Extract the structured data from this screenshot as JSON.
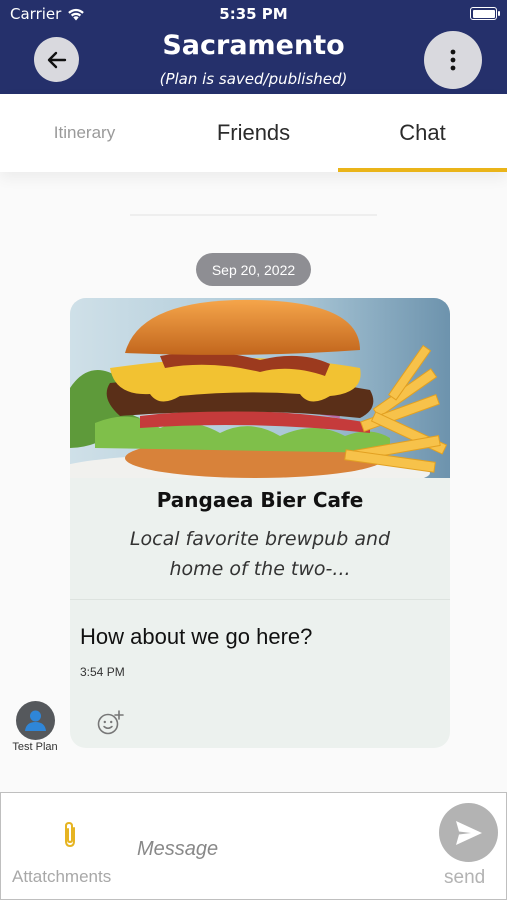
{
  "status_bar": {
    "carrier": "Carrier",
    "time": "5:35 PM"
  },
  "header": {
    "title": "Sacramento",
    "subtitle": "(Plan is saved/published)",
    "back_icon": "arrow-left-icon",
    "more_icon": "vertical-dots-icon",
    "background_color": "#25306b"
  },
  "tabs": [
    {
      "label": "Itinerary",
      "active": false
    },
    {
      "label": "Friends",
      "active": false
    },
    {
      "label": "Chat",
      "active": true
    }
  ],
  "accent_color": "#eab419",
  "chat": {
    "date_separator": "Sep 20, 2022",
    "messages": [
      {
        "sender": "Test Plan",
        "attachment": {
          "image": "burger-and-fries-photo",
          "title": "Pangaea Bier Cafe",
          "description": "Local favorite brewpub and home of the two-..."
        },
        "text": "How about we go here?",
        "time": "3:54 PM"
      }
    ]
  },
  "composer": {
    "attachments_label": "Attatchments",
    "placeholder": "Message",
    "send_label": "send"
  }
}
